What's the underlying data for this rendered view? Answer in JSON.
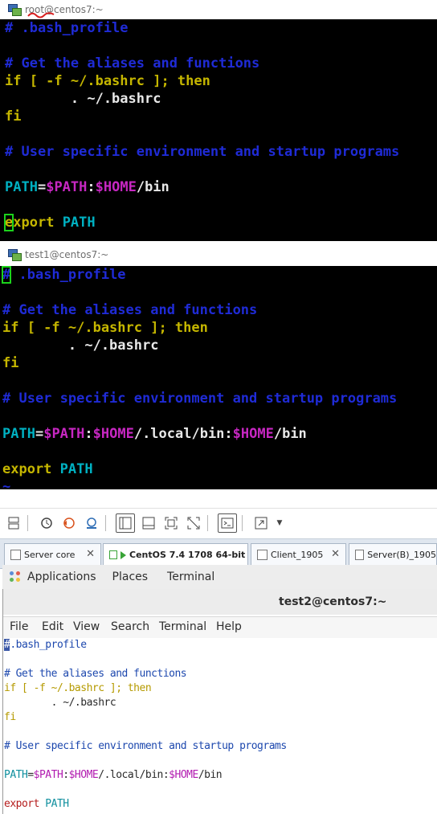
{
  "window1": {
    "title": "root@centos7:~",
    "lines": [
      [
        {
          "t": "# .bash_profile",
          "c": "blue"
        }
      ],
      [],
      [
        {
          "t": "# Get the aliases and functions",
          "c": "blue"
        }
      ],
      [
        {
          "t": "if [ -f ~/.bashrc ]; then",
          "c": "yel"
        }
      ],
      [
        {
          "t": "        . ~/.bashrc",
          "c": "wht"
        }
      ],
      [
        {
          "t": "fi",
          "c": "yel"
        }
      ],
      [],
      [
        {
          "t": "# User specific environment and startup programs",
          "c": "blue"
        }
      ],
      [],
      [
        {
          "t": "PATH",
          "c": "cyan"
        },
        {
          "t": "=",
          "c": "wht"
        },
        {
          "t": "$PATH",
          "c": "mag"
        },
        {
          "t": ":",
          "c": "wht"
        },
        {
          "t": "$HOME",
          "c": "mag"
        },
        {
          "t": "/bin",
          "c": "wht"
        }
      ],
      [],
      [
        {
          "t": "e",
          "c": "yel",
          "cursor": true
        },
        {
          "t": "xport",
          "c": "yel"
        },
        {
          "t": " ",
          "c": "wht"
        },
        {
          "t": "PATH",
          "c": "cyan"
        }
      ]
    ]
  },
  "window2": {
    "title": "test1@centos7:~",
    "lines": [
      [
        {
          "t": "#",
          "c": "blue",
          "cursor": true
        },
        {
          "t": " .bash_profile",
          "c": "blue"
        }
      ],
      [],
      [
        {
          "t": "# Get the aliases and functions",
          "c": "blue"
        }
      ],
      [
        {
          "t": "if [ -f ~/.bashrc ]; then",
          "c": "yel"
        }
      ],
      [
        {
          "t": "        . ~/.bashrc",
          "c": "wht"
        }
      ],
      [
        {
          "t": "fi",
          "c": "yel"
        }
      ],
      [],
      [
        {
          "t": "# User specific environment and startup programs",
          "c": "blue"
        }
      ],
      [],
      [
        {
          "t": "PATH",
          "c": "cyan"
        },
        {
          "t": "=",
          "c": "wht"
        },
        {
          "t": "$PATH",
          "c": "mag"
        },
        {
          "t": ":",
          "c": "wht"
        },
        {
          "t": "$HOME",
          "c": "mag"
        },
        {
          "t": "/.local/bin:",
          "c": "wht"
        },
        {
          "t": "$HOME",
          "c": "mag"
        },
        {
          "t": "/bin",
          "c": "wht"
        }
      ],
      [],
      [
        {
          "t": "export",
          "c": "yel"
        },
        {
          "t": " ",
          "c": "wht"
        },
        {
          "t": "PATH",
          "c": "cyan"
        }
      ],
      [
        {
          "t": "~",
          "c": "blue"
        }
      ]
    ]
  },
  "vm_toolbar": {
    "icons": [
      "network-icon",
      "snapshot-icon",
      "revert-snapshot-icon",
      "manage-snapshots-icon",
      "sidebar-toggle-icon",
      "thumbnail-bar-icon",
      "fullscreen-icon",
      "unity-icon",
      "console-icon",
      "stretch-icon"
    ]
  },
  "vm_tabs": [
    {
      "label": "Server core",
      "selected": false
    },
    {
      "label": "CentOS 7.4 1708 64-bit",
      "selected": true
    },
    {
      "label": "Client_1905",
      "selected": false
    },
    {
      "label": "Server(B)_1905",
      "selected": false
    }
  ],
  "gnome_bar": {
    "applications": "Applications",
    "places": "Places",
    "terminal": "Terminal"
  },
  "gnome_terminal": {
    "title": "test2@centos7:~",
    "menu": [
      "File",
      "Edit",
      "View",
      "Search",
      "Terminal",
      "Help"
    ],
    "lines": [
      [
        {
          "t": "#",
          "c": "gcur"
        },
        {
          "t": ".bash_profile",
          "c": "gb"
        }
      ],
      [],
      [
        {
          "t": "# Get the aliases and functions",
          "c": "gb"
        }
      ],
      [
        {
          "t": "if [ -f ~/.bashrc ]; then",
          "c": "go"
        }
      ],
      [
        {
          "t": "        . ~/.bashrc",
          "c": "gk"
        }
      ],
      [
        {
          "t": "fi",
          "c": "go"
        }
      ],
      [],
      [
        {
          "t": "# User specific environment and startup programs",
          "c": "gb"
        }
      ],
      [],
      [
        {
          "t": "PATH",
          "c": "gc"
        },
        {
          "t": "=",
          "c": "gk"
        },
        {
          "t": "$PATH",
          "c": "gm"
        },
        {
          "t": ":",
          "c": "gk"
        },
        {
          "t": "$HOME",
          "c": "gm"
        },
        {
          "t": "/.local/bin:",
          "c": "gk"
        },
        {
          "t": "$HOME",
          "c": "gm"
        },
        {
          "t": "/bin",
          "c": "gk"
        }
      ],
      [],
      [
        {
          "t": "export",
          "c": "gr"
        },
        {
          "t": " ",
          "c": "gk"
        },
        {
          "t": "PATH",
          "c": "gc"
        }
      ]
    ]
  },
  "colors": {
    "terminal_bg": "#000000",
    "comment_blue": "#1f2bd6",
    "keyword_yellow": "#c5b600",
    "var_magenta": "#c727c2",
    "ident_cyan": "#00b1c2"
  }
}
